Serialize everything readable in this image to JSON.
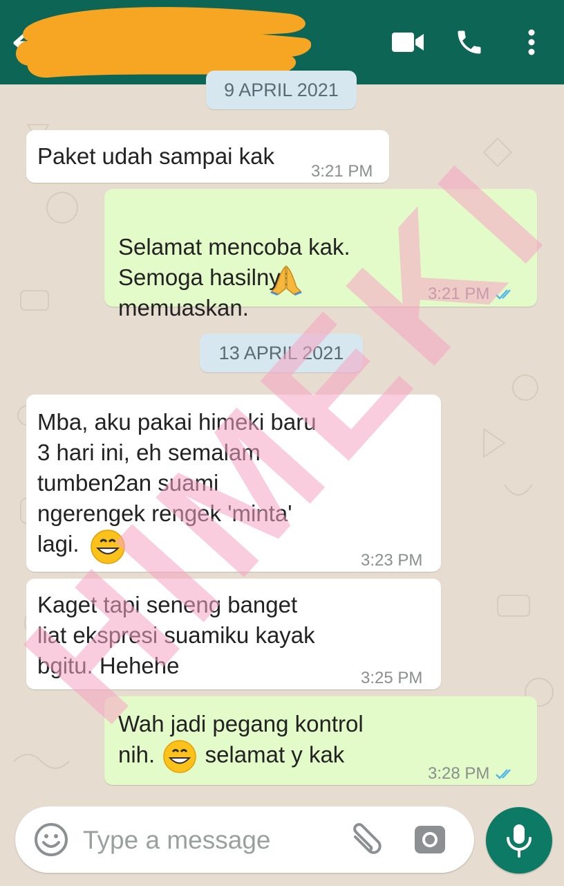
{
  "header": {
    "back_icon": "arrow-left-icon",
    "contact_name": "",
    "video_icon": "video-camera-icon",
    "call_icon": "phone-icon",
    "menu_icon": "more-vertical-icon",
    "bg_color": "#0d6556"
  },
  "chat": {
    "date_chips": [
      {
        "label": "9 APRIL 2021"
      },
      {
        "label": "13 APRIL 2021"
      }
    ],
    "messages": [
      {
        "direction": "incoming",
        "text": "Paket udah sampai kak",
        "time": "3:21 PM"
      },
      {
        "direction": "outgoing",
        "text": "Selamat mencoba kak.\nSemoga hasilnya\nmemuaskan.",
        "emoji": "folded-hands-emoji",
        "time": "3:21 PM",
        "status": "read"
      },
      {
        "direction": "incoming",
        "text": "Mba, aku pakai himeki baru\n3 hari ini, eh semalam\ntumben2an suami\nngerengek rengek 'minta'\nlagi.",
        "emoji": "grinning-face-emoji",
        "time": "3:23 PM"
      },
      {
        "direction": "incoming",
        "text": "Kaget tapi seneng banget\nliat ekspresi suamiku kayak\nbgitu. Hehehe",
        "time": "3:25 PM"
      },
      {
        "direction": "outgoing",
        "text_line1": "Wah jadi pegang kontrol",
        "text_line2_pre": "nih.",
        "emoji": "grinning-face-emoji",
        "text_line2_post": "selamat y kak",
        "time": "3:28 PM",
        "status": "read"
      }
    ],
    "watermark": "HIMEKI",
    "watermark_color": "#f7a5c4"
  },
  "composer": {
    "emoji_icon": "emoji-smiley-icon",
    "placeholder": "Type a message",
    "attach_icon": "paperclip-icon",
    "camera_icon": "camera-icon",
    "mic_icon": "microphone-icon",
    "mic_color": "#0d7a66"
  }
}
